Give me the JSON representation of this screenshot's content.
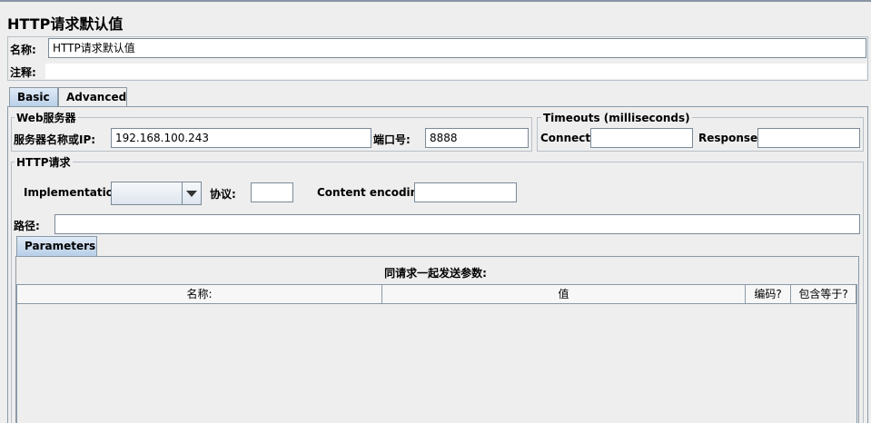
{
  "window": {
    "title": "HTTP请求默认值"
  },
  "name_row": {
    "label": "名称:",
    "value": "HTTP请求默认值"
  },
  "comment_row": {
    "label": "注释:",
    "value": ""
  },
  "tabs": [
    {
      "label": "Basic",
      "selected": true
    },
    {
      "label": "Advanced",
      "selected": false
    }
  ],
  "web_server": {
    "title": "Web服务器",
    "server_label": "服务器名称或IP:",
    "server_value": "192.168.100.243",
    "port_label": "端口号:",
    "port_value": "8888"
  },
  "timeouts": {
    "title": "Timeouts (milliseconds)",
    "connect_label": "Connect:",
    "connect_value": "",
    "response_label": "Response:",
    "response_value": ""
  },
  "http_request": {
    "title": "HTTP请求",
    "implementation_label": "Implementation:",
    "implementation_value": "",
    "protocol_label": "协议:",
    "protocol_value": "",
    "encoding_label": "Content encoding:",
    "encoding_value": "",
    "path_label": "路径:",
    "path_value": ""
  },
  "params_tab": {
    "label": "Parameters"
  },
  "params_table": {
    "caption": "同请求一起发送参数:",
    "columns": [
      "名称:",
      "值",
      "编码?",
      "包含等于?"
    ]
  }
}
